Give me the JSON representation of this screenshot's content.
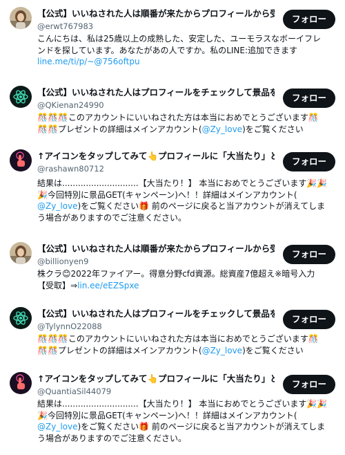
{
  "follow_label": "フォロー",
  "colors": {
    "link": "#1d9bf0",
    "button": "#0f1419",
    "handle": "#536471"
  },
  "accounts": [
    {
      "avatar": "woman-photo-avatar",
      "name": "【公式】いいねされた人は順番が来たからプロフィールから受取",
      "handle": "@erwt767983",
      "bio_lines": [
        "こんにちは、私は25歳以上の成熟した、安定した、ユーモラスなボーイフレ",
        "ンドを探しています。あなたがあの人ですか。私のLINE:追加できます"
      ],
      "bio_link": "line.me/ti/p/~@756oftpu"
    },
    {
      "avatar": "green-atom-avatar",
      "name": "【公式】いいねされた人はプロフィールをチェックして景品を",
      "handle": "@QKienan24990",
      "bio_lines": [
        "🎊🎊🎊このアカウントにいいねされた方は本当におめでとうございます🎊",
        "🎊🎊プレゼントの詳細はメインアカウント(",
        "@Zy_love",
        ")をご覧ください"
      ]
    },
    {
      "avatar": "tap-hand-avatar",
      "name": "↑アイコンをタップしてみて👆プロフィールに「大当たり」と",
      "handle": "@rashawn80712",
      "bio_lines": [
        "結果は.............................【大当たり！】 本当におめでとうございます🎉🎉",
        "🎉今回特別に景品GET(キャンペーン)へ！！詳細はメインアカウント(",
        "@Zy_love",
        ")をご覧ください🎁 前のページに戻ると当アカウントが消えてしま",
        "う場合がありますのでご注意ください。"
      ]
    },
    {
      "avatar": "woman-photo-avatar",
      "name": "【公式】いいねされた人は順番が来たからプロフィールから受",
      "handle": "@billionyen9",
      "bio_lines": [
        "株クラ😊2022年ファイアー。得意分野cfd資源。総資産7億超え※暗号入力",
        "【受取】⇒",
        "lin.ee/eEZSpxe"
      ]
    },
    {
      "avatar": "green-atom-avatar",
      "name": "【公式】いいねされた人はプロフィールをチェックして景品を",
      "handle": "@TylynnO22088",
      "bio_lines": [
        "🎊🎊🎊このアカウントにいいねされた方は本当におめでとうございます🎊",
        "🎊🎊プレゼントの詳細はメインアカウント(",
        "@Zy_love",
        ")をご覧ください"
      ]
    },
    {
      "avatar": "tap-hand-avatar",
      "name": "↑アイコンをタップしてみて👆プロフィールに「大当たり」と",
      "handle": "@QuantiaSil44079",
      "bio_lines": [
        "結果は.............................【大当たり！】 本当におめでとうございます🎉🎉",
        "🎉今回特別に景品GET(キャンペーン)へ！！詳細はメインアカウント(",
        "@Zy_love",
        ")をご覧ください🎁 前のページに戻ると当アカウントが消えてしま",
        "う場合がありますのでご注意ください。"
      ]
    }
  ]
}
